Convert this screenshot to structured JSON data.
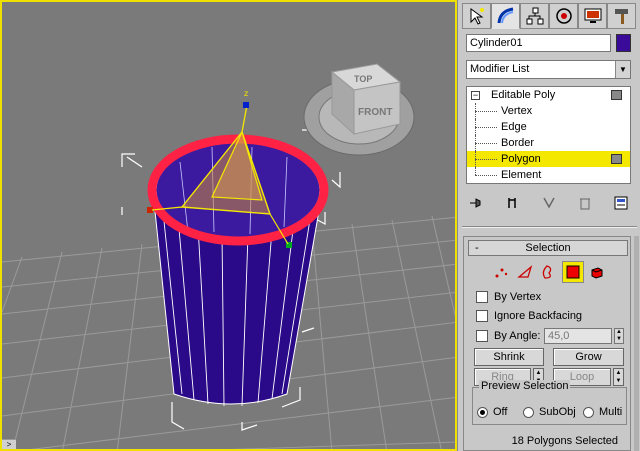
{
  "viewport": {
    "viewcube": {
      "top_label": "TOP",
      "front_label": "FRONT"
    },
    "axis_label": "z",
    "bottom_arrow": ">"
  },
  "command_panel": {
    "tabs": [
      {
        "name": "create-tab",
        "icon": "pointer-star-icon"
      },
      {
        "name": "modify-tab",
        "icon": "modify-arc-icon",
        "active": true
      },
      {
        "name": "hierarchy-tab",
        "icon": "hierarchy-icon"
      },
      {
        "name": "motion-tab",
        "icon": "motion-circle-icon"
      },
      {
        "name": "display-tab",
        "icon": "display-monitor-icon"
      },
      {
        "name": "utilities-tab",
        "icon": "hammer-icon"
      }
    ],
    "object_name": "Cylinder01",
    "object_color": "#3a0a99",
    "modifier_list": {
      "label": "Modifier List"
    },
    "stack": {
      "root": "Editable Poly",
      "root_expander": "−",
      "items": [
        "Vertex",
        "Edge",
        "Border",
        "Polygon",
        "Element"
      ],
      "selected": "Polygon"
    }
  },
  "selection": {
    "title": "Selection",
    "collapse": "-",
    "by_vertex": "By Vertex",
    "ignore_backfacing": "Ignore Backfacing",
    "by_angle": "By Angle:",
    "angle_value": "45,0",
    "shrink": "Shrink",
    "grow": "Grow",
    "ring": "Ring",
    "loop": "Loop",
    "preview_title": "Preview Selection",
    "preview_off": "Off",
    "preview_subobj": "SubObj",
    "preview_multi": "Multi",
    "status": "18 Polygons Selected"
  },
  "colors": {
    "viewport_border": "#f0e000",
    "highlight": "#f5e800",
    "cylinder": "#2a0a88",
    "rim": "#ff2244"
  }
}
